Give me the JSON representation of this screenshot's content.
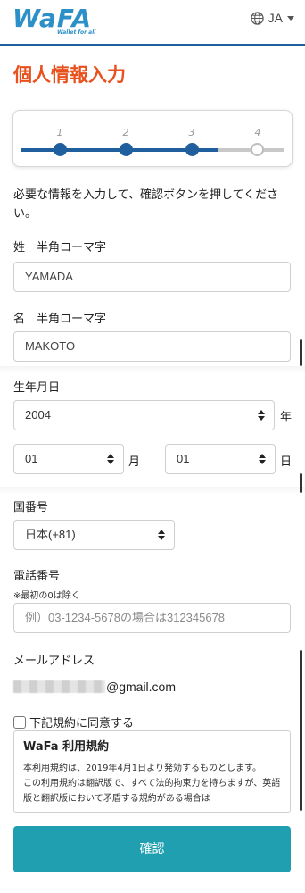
{
  "header": {
    "logo_text": "WaFA",
    "logo_tagline": "Wallet for all",
    "language": "JA"
  },
  "page_title": "個人情報入力",
  "stepper": {
    "steps": [
      "1",
      "2",
      "3",
      "4"
    ],
    "current_step": 3
  },
  "intro_text": "必要な情報を入力して、確認ボタンを押してください。",
  "last_name": {
    "label": "姓　半角ローマ字",
    "value": "YAMADA"
  },
  "first_name": {
    "label": "名　半角ローマ字",
    "value": "MAKOTO"
  },
  "birthdate": {
    "label": "生年月日",
    "year": "2004",
    "year_suffix": "年",
    "month": "01",
    "month_suffix": "月",
    "day": "01",
    "day_suffix": "日"
  },
  "country_code": {
    "label": "国番号",
    "value": "日本(+81)"
  },
  "phone": {
    "label": "電話番号",
    "note": "※最初の0は除く",
    "placeholder": "例）03-1234-5678の場合は312345678"
  },
  "email": {
    "label": "メールアドレス",
    "domain": "@gmail.com"
  },
  "consent": {
    "label": "下記規約に同意する"
  },
  "terms": {
    "title": "WaFa 利用規約",
    "line1": "本利用規約は、2019年4月1日より発効するものとします。",
    "line2": "この利用規約は翻訳版で、すべて法的拘束力を持ちますが、英語版と翻訳版において矛盾する規約がある場合は"
  },
  "confirm_button": "確認",
  "colors": {
    "accent_blue": "#1f5f9e",
    "title_orange": "#e8501c",
    "button_teal": "#1f9fb0"
  }
}
